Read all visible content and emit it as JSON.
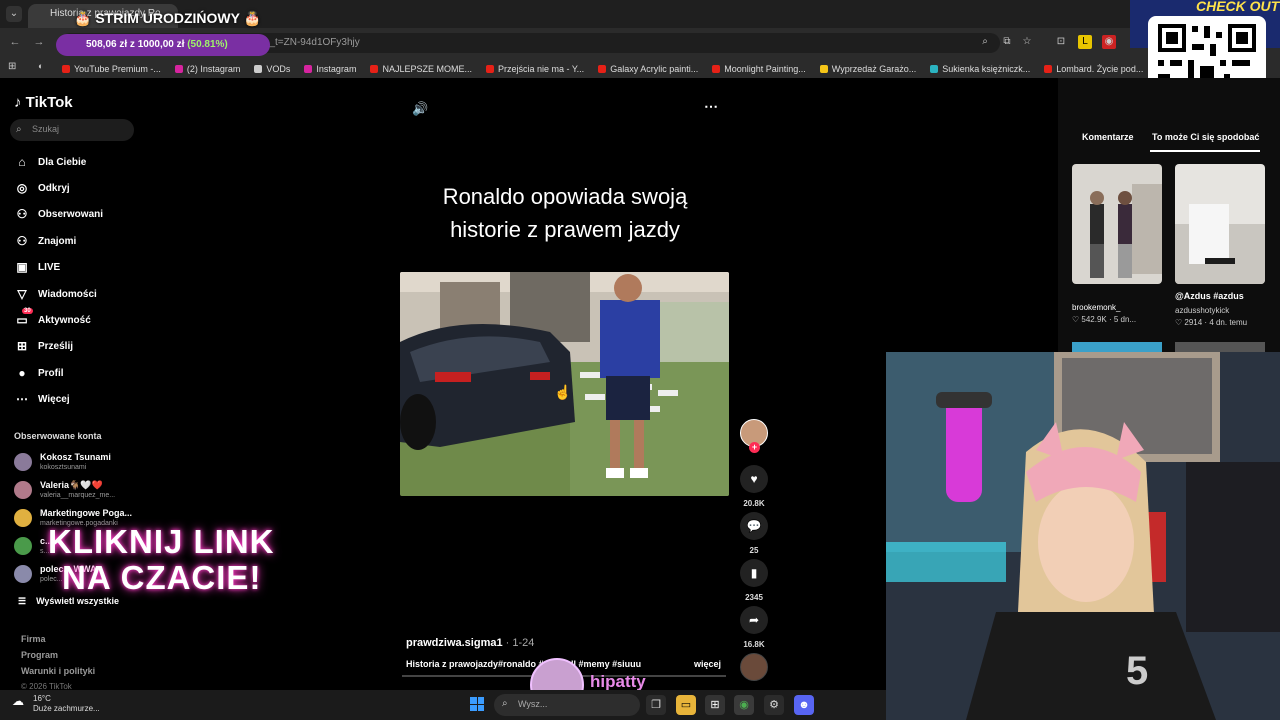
{
  "browser": {
    "tab_title": "Historia z prawojazdy Ro...",
    "url": "...ma1/video/7598998760017890582?_r=1&_t=ZN-94d1OFy3hjy",
    "bookmarks": [
      {
        "label": "YouTube Premium -...",
        "color": "#e62117"
      },
      {
        "label": "(2) Instagram",
        "color": "#d6249f"
      },
      {
        "label": "VODs",
        "color": "#cccccc"
      },
      {
        "label": "Instagram",
        "color": "#d6249f"
      },
      {
        "label": "NAJLEPSZE MOME...",
        "color": "#e62117"
      },
      {
        "label": "Przejścia nie ma - Y...",
        "color": "#e62117"
      },
      {
        "label": "Galaxy Acrylic painti...",
        "color": "#e62117"
      },
      {
        "label": "Moonlight Painting...",
        "color": "#e62117"
      },
      {
        "label": "Wyprzedaż Garażo...",
        "color": "#f5c518"
      },
      {
        "label": "Sukienka księżniczk...",
        "color": "#2bb3c0"
      },
      {
        "label": "Lombard. Życie pod...",
        "color": "#e62117"
      }
    ]
  },
  "stream_overlay": {
    "title": "STRIM URODZIŃOWY",
    "donation": {
      "amount": "508,06 zł z 1000,00 zł",
      "percent": "(50.81%)",
      "progress": 0.5081
    },
    "qr_banner": "CHECK OUT",
    "promo_line1": "KLIKNIJ LINK",
    "promo_line2": "NA CZACIE!",
    "streamer_name": "hipatty"
  },
  "sidebar": {
    "logo": "TikTok",
    "search_placeholder": "Szukaj",
    "nav": [
      {
        "label": "Dla Ciebie",
        "icon": "home-icon",
        "glyph": "⌂"
      },
      {
        "label": "Odkryj",
        "icon": "compass-icon",
        "glyph": "◎"
      },
      {
        "label": "Obserwowani",
        "icon": "following-icon",
        "glyph": "⚇"
      },
      {
        "label": "Znajomi",
        "icon": "friends-icon",
        "glyph": "⚇"
      },
      {
        "label": "LIVE",
        "icon": "live-icon",
        "glyph": "▣"
      },
      {
        "label": "Wiadomości",
        "icon": "messages-icon",
        "glyph": "▽"
      },
      {
        "label": "Aktywność",
        "icon": "activity-icon",
        "glyph": "▭",
        "badge": "30"
      },
      {
        "label": "Prześlij",
        "icon": "upload-icon",
        "glyph": "⊞"
      },
      {
        "label": "Profil",
        "icon": "profile-icon",
        "glyph": "●"
      },
      {
        "label": "Więcej",
        "icon": "more-icon",
        "glyph": "⋯"
      }
    ],
    "followed_header": "Obserwowane konta",
    "followed": [
      {
        "name": "Kokosz Tsunami",
        "handle": "kokosztsunami"
      },
      {
        "name": "Valeria🐐🤍❤️",
        "handle": "valeria__marquez_me..."
      },
      {
        "name": "Marketingowe Poga...",
        "handle": "marketingowe.pogadanki"
      },
      {
        "name": "c...",
        "handle": "s..."
      },
      {
        "name": "polec... WWA",
        "handle": "polec..."
      }
    ],
    "show_all": "Wyświetl wszystkie",
    "footer": [
      "Firma",
      "Program",
      "Warunki i polityki"
    ],
    "copyright": "© 2026 TikTok"
  },
  "video": {
    "title_line1": "Ronaldo opowiada swoją",
    "title_line2": "historie z prawem jazdy",
    "creator": "prawdziwa.sigma1",
    "date": " · 1-24",
    "description": "Historia z prawojazdy#ronaldo #c... ...all #memy #siuuu",
    "more": "więcej",
    "likes": "20.8K",
    "comments": "25",
    "saves": "2345",
    "shares": "16.8K"
  },
  "right_panel": {
    "tab_comments": "Komentarze",
    "tab_like": "To może Ci się spodobać",
    "thumbs": [
      {
        "user": "brookemonk_",
        "likes": "542.9K",
        "age": "5 dn..."
      },
      {
        "user": "@Azdus #azdus",
        "sub": "azdusshotykick",
        "likes": "2914",
        "age": "4 dn. temu"
      }
    ]
  },
  "taskbar": {
    "temp": "16°C",
    "weather": "Duże zachmurze...",
    "search": "Wysz..."
  }
}
